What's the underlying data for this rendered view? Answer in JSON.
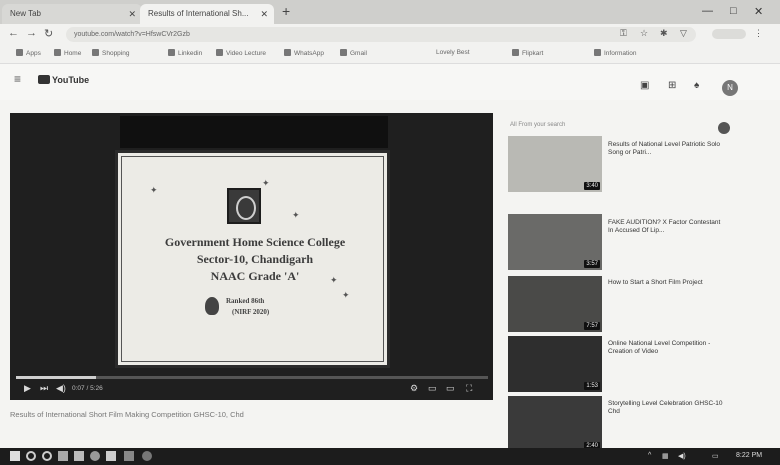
{
  "browser": {
    "tabs": [
      {
        "label": "New Tab"
      },
      {
        "label": "Results of International Sh..."
      }
    ],
    "new_tab": "+",
    "address": "youtube.com/watch?v=HfswCVr2Gzb",
    "bookmarks": [
      "Apps",
      "Home",
      "Shopping",
      "Linkedin",
      "Video Lecture",
      "WhatsApp",
      "Gmail",
      "Lovely Best",
      "Flipkart",
      "Information"
    ]
  },
  "youtube": {
    "logo": "YouTube",
    "avatar_letter": "N"
  },
  "player": {
    "slide": {
      "line1": "Government Home Science College",
      "line2": "Sector-10, Chandigarh",
      "line3": "NAAC Grade 'A'",
      "ranked": "Ranked 86th",
      "nirf": "(NIRF 2020)"
    },
    "time": "0:07 / 5:26",
    "progress_fraction": 0.17
  },
  "video": {
    "title": "Results of International Short Film Making Competition GHSC-10, Chd"
  },
  "sidebar": {
    "chips": "All    From your search",
    "items": [
      {
        "title": "Results of National Level Patriotic Solo Song or Patri...",
        "duration": "3:40",
        "thumb": "#b9b9b4"
      },
      {
        "title": "FAKE AUDITION? X Factor Contestant In Accused Of Lip...",
        "duration": "3:57",
        "thumb": "#6a6a68"
      },
      {
        "title": "How to Start a Short Film Project",
        "duration": "7:57",
        "thumb": "#4a4a48"
      },
      {
        "title": "Online National Level Competition - Creation of Video",
        "duration": "1:53",
        "thumb": "#2e2e2e"
      },
      {
        "title": "Storytelling Level Celebration GHSC-10 Chd",
        "duration": "2:40",
        "thumb": "#3a3a3a"
      }
    ]
  },
  "taskbar": {
    "clock": "8:22 PM"
  },
  "colors": {
    "taskbar": "#1c1c1c",
    "page": "#f4f4f2"
  }
}
